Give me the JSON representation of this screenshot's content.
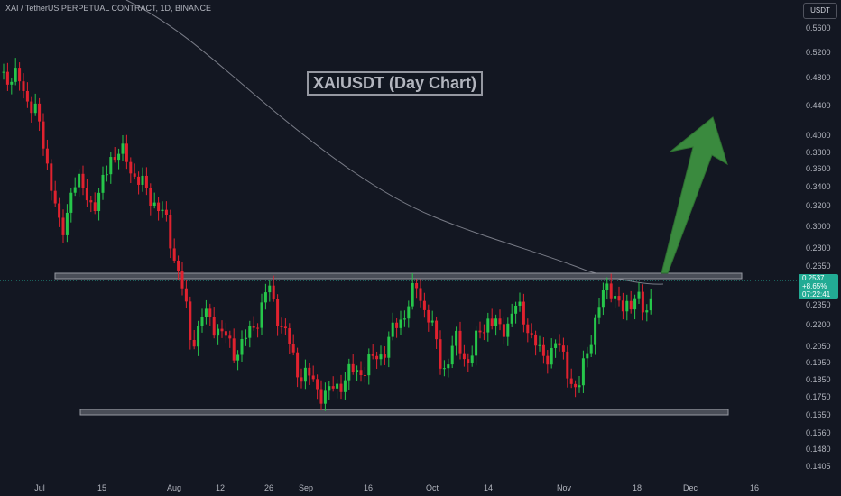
{
  "header": {
    "title": "XAI / TetherUS PERPETUAL CONTRACT, 1D, BINANCE"
  },
  "annotation": {
    "label": "XAIUSDT (Day Chart)",
    "arrow_color": "#3a8a3e"
  },
  "price_axis": {
    "currency": "USDT",
    "ticks": [
      "0.5600",
      "0.5200",
      "0.4800",
      "0.4400",
      "0.4000",
      "0.3800",
      "0.3600",
      "0.3400",
      "0.3200",
      "0.3000",
      "0.2800",
      "0.2650",
      "0.2350",
      "0.2200",
      "0.2050",
      "0.1950",
      "0.1850",
      "0.1750",
      "0.1650",
      "0.1560",
      "0.1480",
      "0.1405"
    ],
    "current_price": "0.2537",
    "change": "+8.65%",
    "countdown": "07:22:41"
  },
  "time_axis": {
    "ticks": [
      "Jul",
      "15",
      "Aug",
      "12",
      "26",
      "Sep",
      "16",
      "Oct",
      "14",
      "Nov",
      "18",
      "Dec",
      "16"
    ]
  },
  "colors": {
    "background": "#131722",
    "up": "#22ab94",
    "down": "#f23645",
    "bullish_candle": "#26c64a",
    "bearish_candle": "#e0222f",
    "ma_line": "#9598a1",
    "zone_fill": "#4a4e58"
  }
}
